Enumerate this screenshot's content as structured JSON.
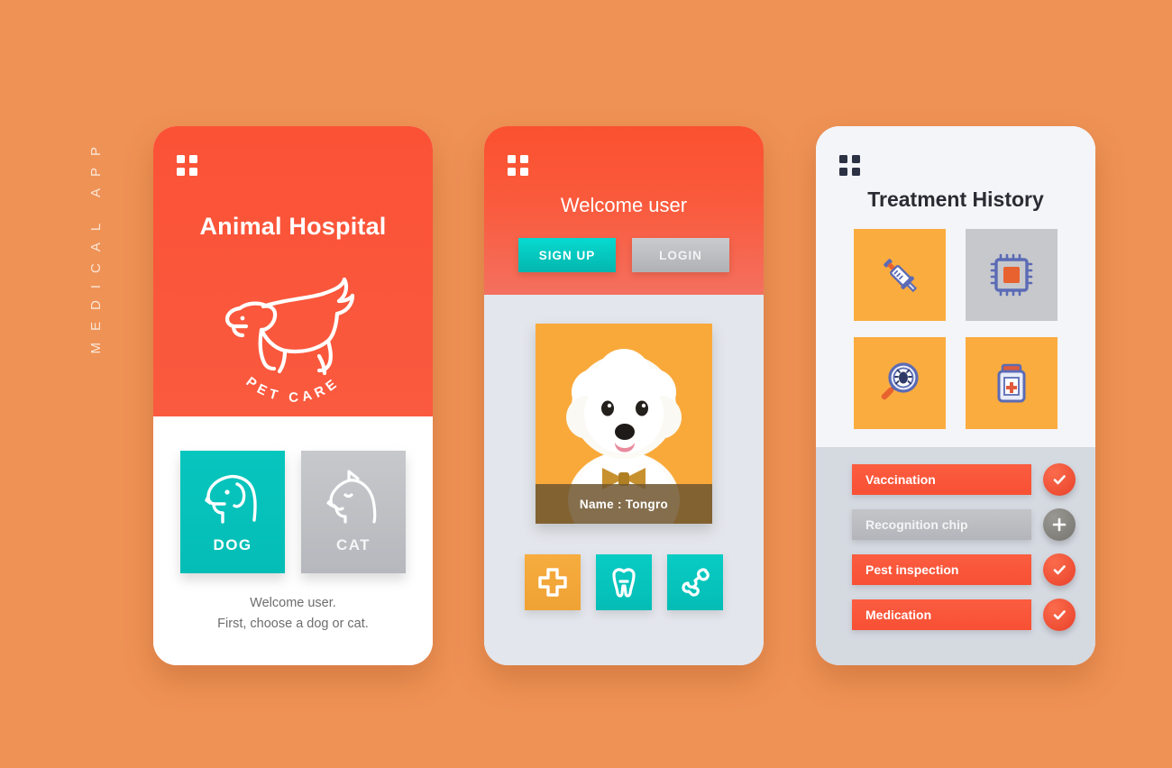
{
  "page": {
    "side_label": "MEDICAL APP",
    "background_color": "#EF9256"
  },
  "colors": {
    "red": "#FA5436",
    "teal": "#05BEB6",
    "orange_tile": "#FBAC3F",
    "gray_tile": "#C6C8CC",
    "dark_text": "#2B2B33"
  },
  "phone1": {
    "menu_icon": "grid-menu-icon",
    "title": "Animal Hospital",
    "logo": {
      "icon": "running-dog-line-icon",
      "caption": "PET CARE"
    },
    "choices": [
      {
        "label": "DOG",
        "icon": "dog-head-icon",
        "state": "selected"
      },
      {
        "label": "CAT",
        "icon": "cat-head-icon",
        "state": "unselected"
      }
    ],
    "note_line1": "Welcome user.",
    "note_line2": "First, choose a dog or cat."
  },
  "phone2": {
    "menu_icon": "grid-menu-icon",
    "title": "Welcome user",
    "buttons": [
      {
        "label": "SIGN UP",
        "style": "teal"
      },
      {
        "label": "LOGIN",
        "style": "gray"
      }
    ],
    "pet_card": {
      "photo_alt": "bichon-frise-photo",
      "name_label": "Name : Tongro"
    },
    "action_tiles": [
      {
        "icon": "medical-cross-icon",
        "style": "orange"
      },
      {
        "icon": "tooth-icon",
        "style": "teal"
      },
      {
        "icon": "bone-joint-icon",
        "style": "teal"
      }
    ]
  },
  "phone3": {
    "menu_icon": "grid-menu-icon",
    "title": "Treatment History",
    "tiles": [
      {
        "icon": "syringe-icon",
        "style": "orange"
      },
      {
        "icon": "microchip-icon",
        "style": "gray"
      },
      {
        "icon": "magnifier-bug-icon",
        "style": "orange"
      },
      {
        "icon": "medicine-bottle-icon",
        "style": "orange"
      }
    ],
    "records": [
      {
        "label": "Vaccination",
        "status": "done",
        "action_icon": "check-icon"
      },
      {
        "label": "Recognition chip",
        "status": "pending",
        "action_icon": "plus-icon"
      },
      {
        "label": "Pest inspection",
        "status": "done",
        "action_icon": "check-icon"
      },
      {
        "label": "Medication",
        "status": "done",
        "action_icon": "check-icon"
      }
    ]
  }
}
